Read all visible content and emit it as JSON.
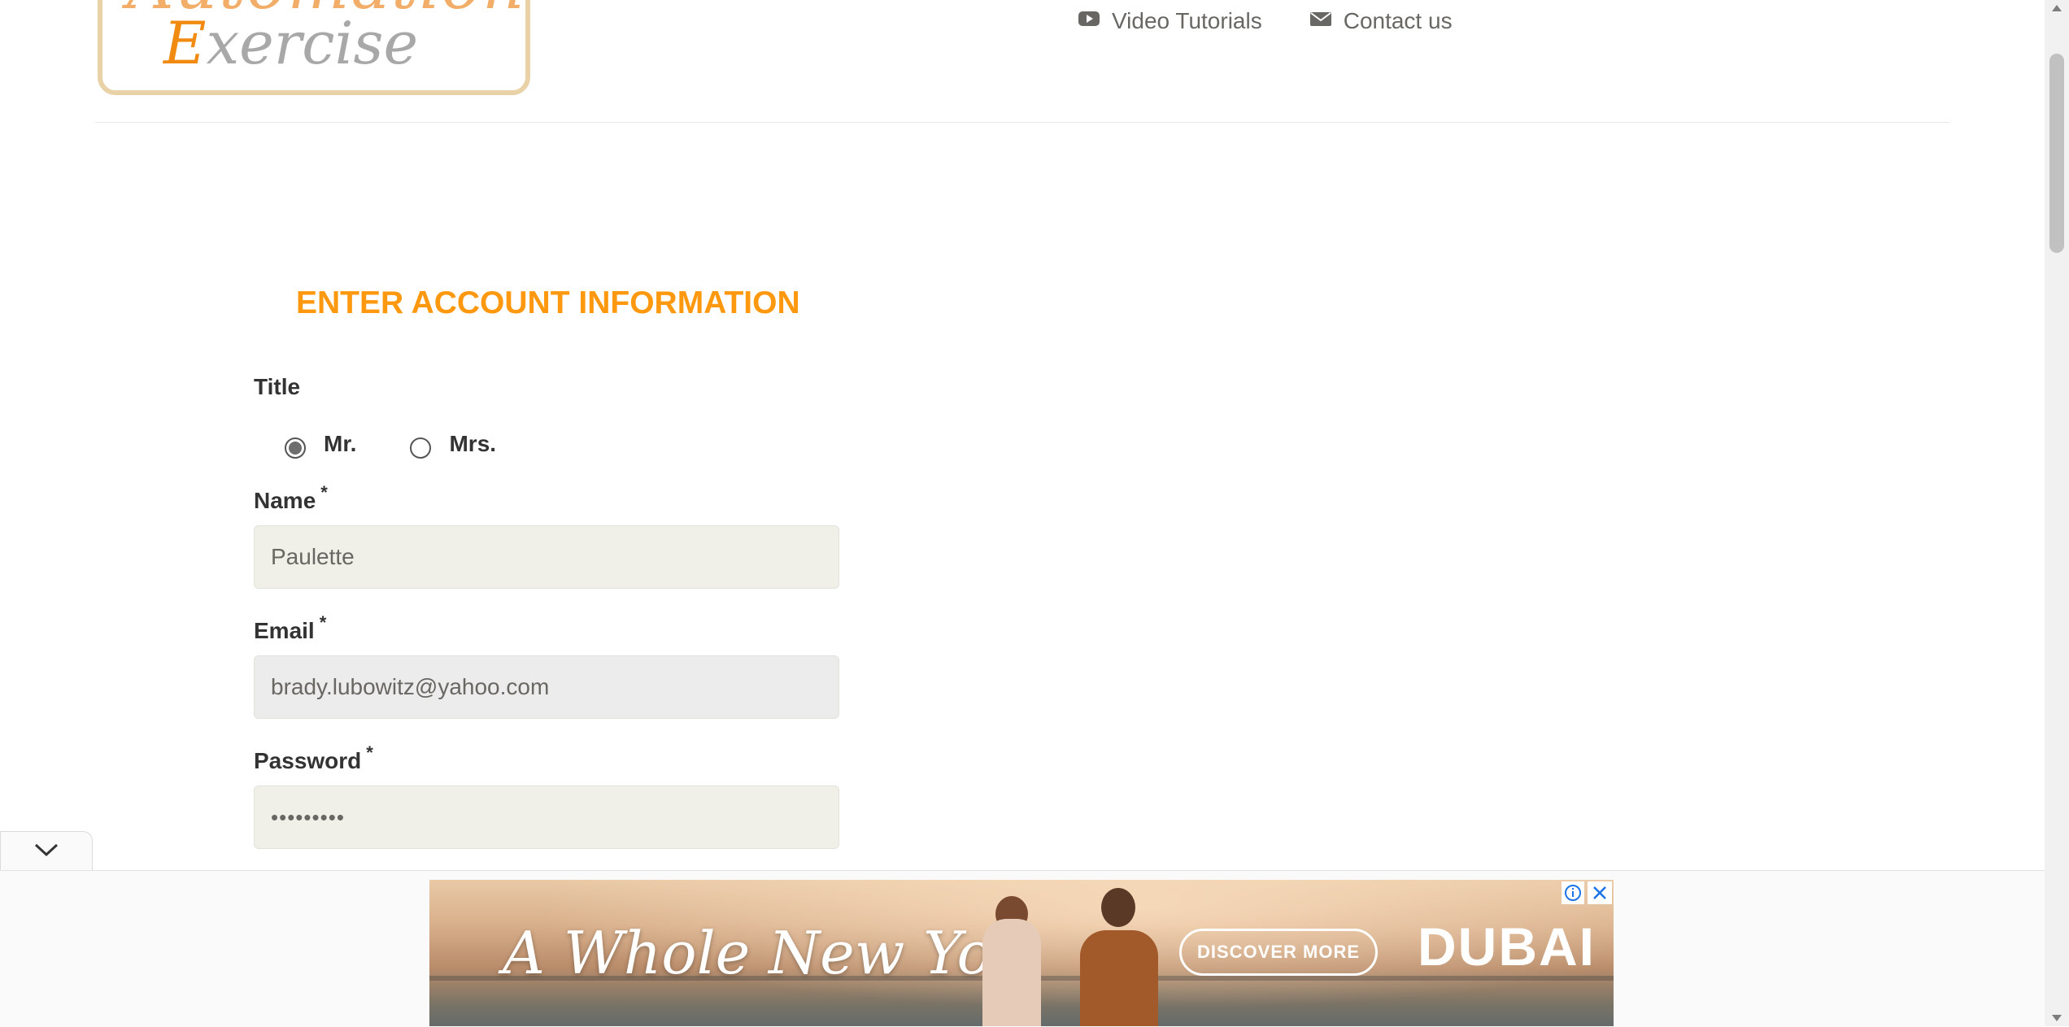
{
  "header": {
    "logo_text_line1": "Automation",
    "logo_text_line2_cap": "E",
    "logo_text_line2_rest": "xercise",
    "nav": {
      "video_tutorials": "Video Tutorials",
      "contact_us": "Contact us"
    }
  },
  "form": {
    "heading": "ENTER ACCOUNT INFORMATION",
    "title_label": "Title",
    "title_options": [
      {
        "label": "Mr.",
        "checked": true
      },
      {
        "label": "Mrs.",
        "checked": false
      }
    ],
    "name": {
      "label": "Name",
      "required": "*",
      "value": "Paulette"
    },
    "email": {
      "label": "Email",
      "required": "*",
      "value": "brady.lubowitz@yahoo.com"
    },
    "password": {
      "label": "Password",
      "required": "*",
      "value": "•••••••••"
    }
  },
  "ad": {
    "headline": "A Whole New You",
    "cta": "DISCOVER MORE",
    "brand": "DUBAI"
  },
  "colors": {
    "accent": "#FE980F",
    "nav_text": "#696763",
    "logo_border": "#E9D2A8"
  }
}
